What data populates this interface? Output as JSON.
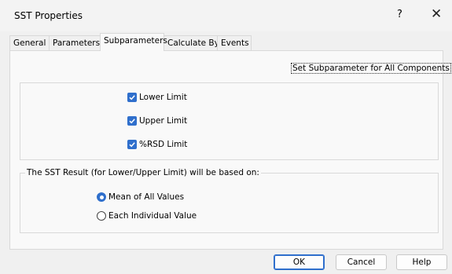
{
  "dialog": {
    "title": "SST Properties",
    "help_glyph": "?",
    "close_glyph": "✕"
  },
  "tabs": [
    {
      "label": "General",
      "active": false
    },
    {
      "label": "Parameters",
      "active": false
    },
    {
      "label": "Subparameters",
      "active": true
    },
    {
      "label": "Calculate By",
      "active": false
    },
    {
      "label": "Events",
      "active": false
    }
  ],
  "set_all": {
    "label": "Set Subparameter for All Components",
    "checked": true
  },
  "limits": [
    {
      "label": "Lower Limit",
      "checked": true
    },
    {
      "label": "Upper Limit",
      "checked": true
    },
    {
      "label": "%RSD Limit",
      "checked": true
    }
  ],
  "result_group": {
    "title": "The SST Result (for Lower/Upper Limit) will be based on:",
    "options": [
      {
        "label": "Mean of All Values",
        "selected": true
      },
      {
        "label": "Each Individual Value",
        "selected": false
      }
    ]
  },
  "buttons": {
    "ok": "OK",
    "cancel": "Cancel",
    "help": "Help"
  },
  "colors": {
    "accent": "#2f6fcc"
  }
}
